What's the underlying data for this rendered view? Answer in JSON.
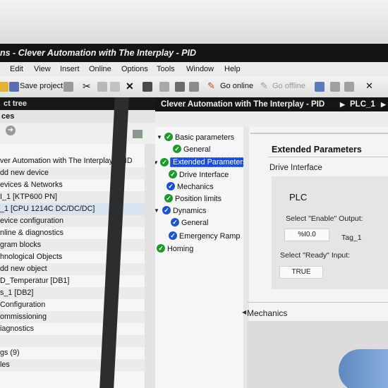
{
  "window": {
    "title": "ns - Clever Automation with The Interplay - PID"
  },
  "menu": [
    "Edit",
    "View",
    "Insert",
    "Online",
    "Options",
    "Tools",
    "Window",
    "Help"
  ],
  "toolbar": {
    "save_project": "Save project",
    "go_online": "Go online",
    "go_offline": "Go offline"
  },
  "project_tree": {
    "header": "ct tree",
    "tab": "ces",
    "items": [
      "ver Automation with The Interplay - PID",
      "dd new device",
      "evices & Networks",
      "I_1 [KTP600 PN]",
      "_1 [CPU 1214C DC/DC/DC]",
      "evice configuration",
      "nline & diagnostics",
      "gram blocks",
      "hnological Objects",
      "dd new object",
      "D_Temperatur [DB1]",
      "s_1 [DB2]",
      "Configuration",
      "ommissioning",
      "iagnostics",
      "",
      "gs (9)",
      "les"
    ]
  },
  "editor": {
    "breadcrumb": "Clever Automation with The Interplay - PID",
    "breadcrumb_device": "PLC_1",
    "nav": {
      "basic": "Basic parameters",
      "general1": "General",
      "extended": "Extended Parameters",
      "drive": "Drive Interface",
      "mechanics": "Mechanics",
      "position": "Position limits",
      "dynamics": "Dynamics",
      "general2": "General",
      "emergency": "Emergency Ramp",
      "homing": "Homing"
    },
    "section_title": "Extended Parameters",
    "drive_interface": "Drive Interface",
    "plc": "PLC",
    "enable_label": "Select \"Enable\" Output:",
    "enable_value": "%I0.0",
    "enable_tag": "Tag_1",
    "ready_label": "Select \"Ready\" Input:",
    "ready_value": "TRUE",
    "mechanics_title": "Mechanics"
  },
  "colors": {
    "check_green": "#1e9a2c",
    "check_blue": "#1d55c8",
    "selection": "#1b4fd0",
    "title_bar": "#141414"
  }
}
